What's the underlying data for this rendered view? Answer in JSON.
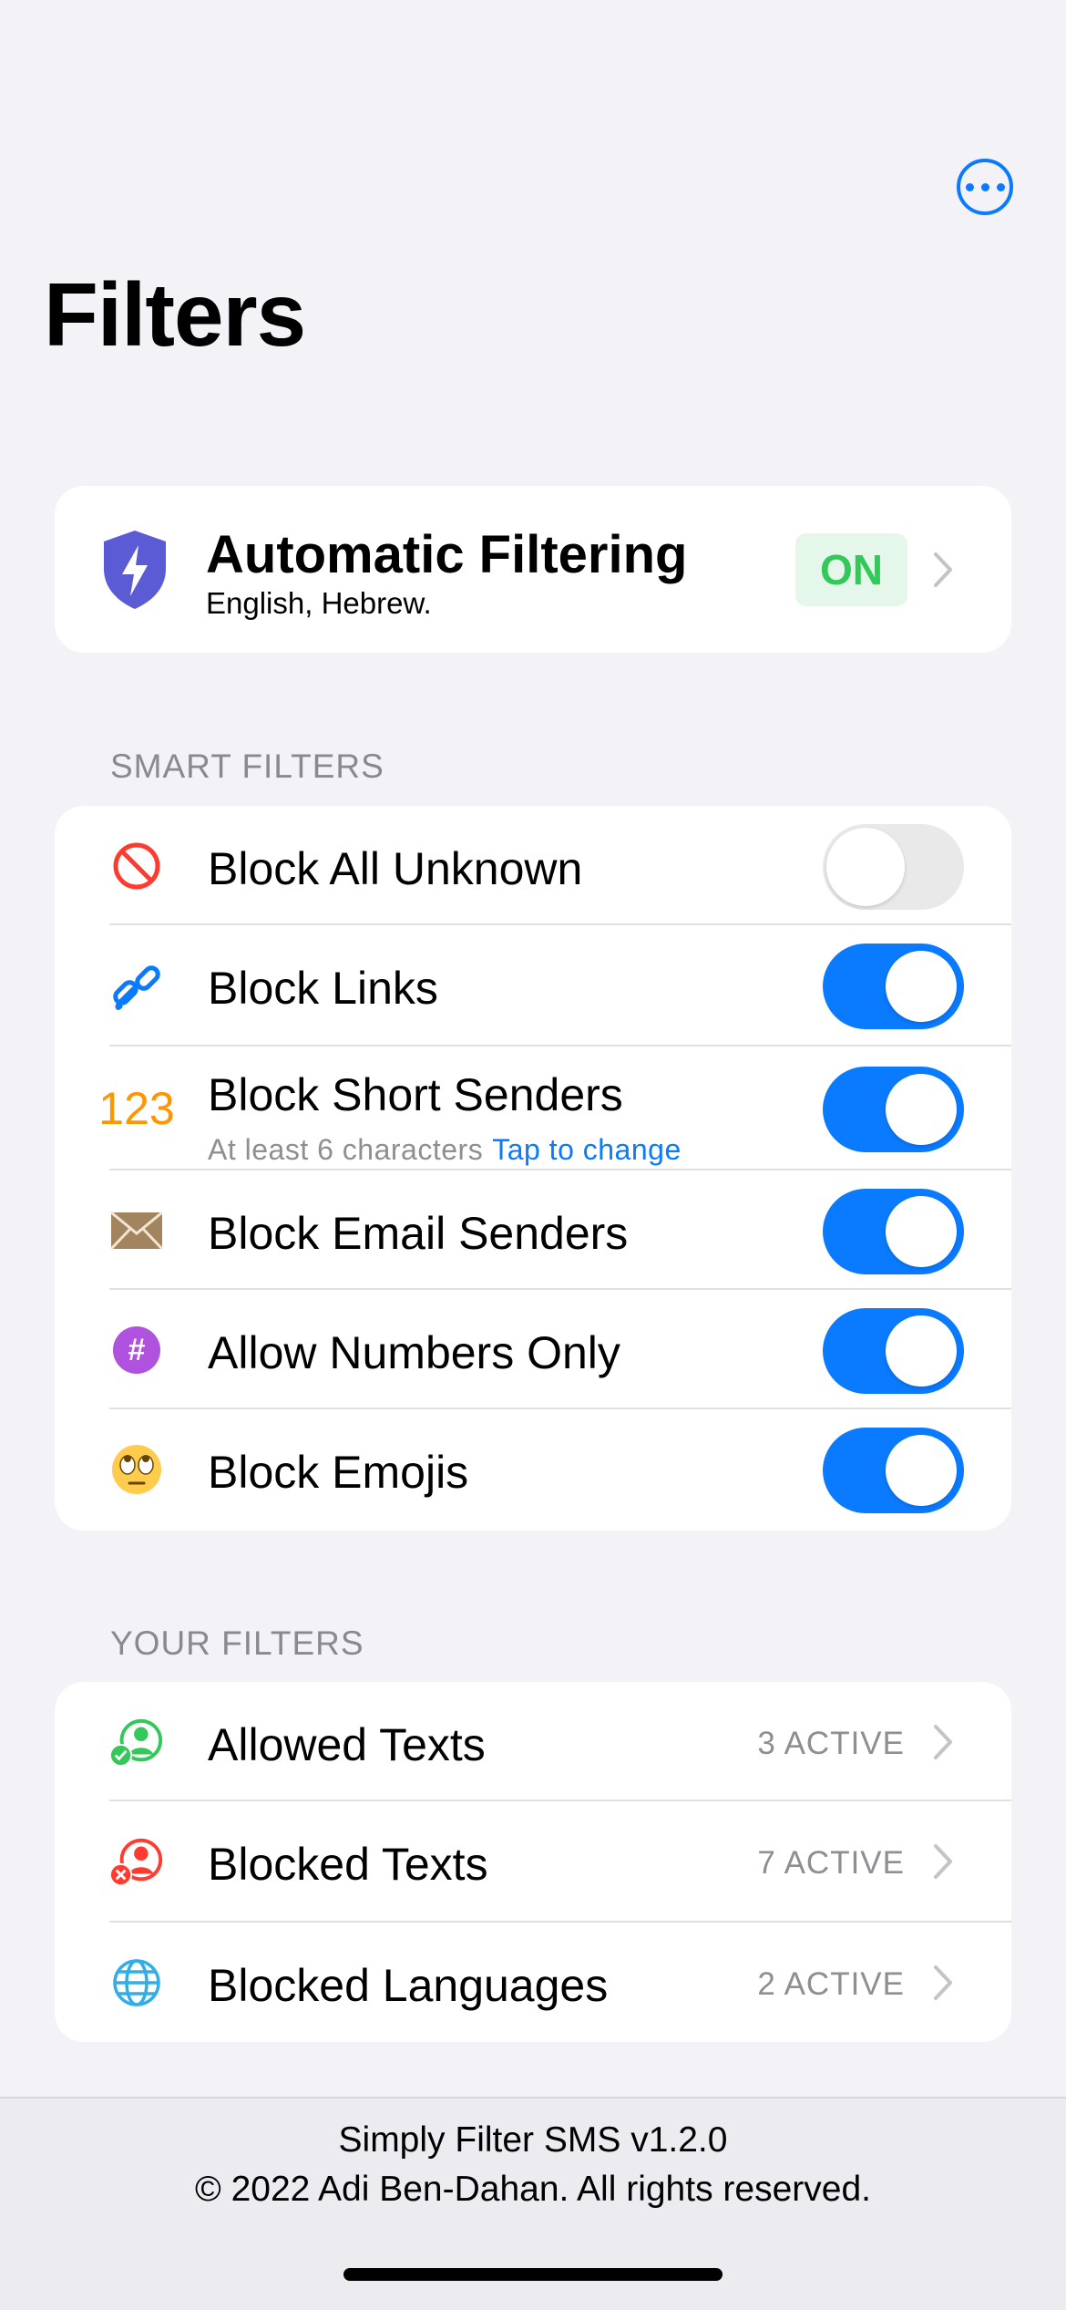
{
  "header": {
    "title": "Filters",
    "more_icon": "ellipsis-circle-icon"
  },
  "auto_filtering": {
    "title": "Automatic Filtering",
    "subtitle": "English, Hebrew.",
    "status": "ON",
    "icon": "shield-bolt-icon"
  },
  "smart_filters": {
    "heading": "SMART FILTERS",
    "items": [
      {
        "label": "Block All Unknown",
        "icon": "prohibited-icon",
        "enabled": false
      },
      {
        "label": "Block Links",
        "icon": "link-icon",
        "enabled": true
      },
      {
        "label": "Block Short Senders",
        "icon": "123",
        "subtitle": "At least 6 characters",
        "subtitle_link": "Tap to change",
        "enabled": true
      },
      {
        "label": "Block Email Senders",
        "icon": "envelope-icon",
        "enabled": true
      },
      {
        "label": "Allow Numbers Only",
        "icon": "#",
        "enabled": true
      },
      {
        "label": "Block Emojis",
        "icon": "eye-roll-emoji-icon",
        "enabled": true
      }
    ]
  },
  "your_filters": {
    "heading": "YOUR FILTERS",
    "items": [
      {
        "label": "Allowed Texts",
        "count": "3 ACTIVE",
        "icon": "person-check-icon"
      },
      {
        "label": "Blocked Texts",
        "count": "7 ACTIVE",
        "icon": "person-x-icon"
      },
      {
        "label": "Blocked Languages",
        "count": "2 ACTIVE",
        "icon": "globe-icon"
      }
    ]
  },
  "footer": {
    "version": "Simply Filter SMS v1.2.0",
    "copyright": "© 2022 Adi Ben-Dahan. All rights reserved."
  },
  "colors": {
    "accent": "#0a7aff",
    "on_green": "#34c759",
    "background": "#f2f2f7"
  }
}
